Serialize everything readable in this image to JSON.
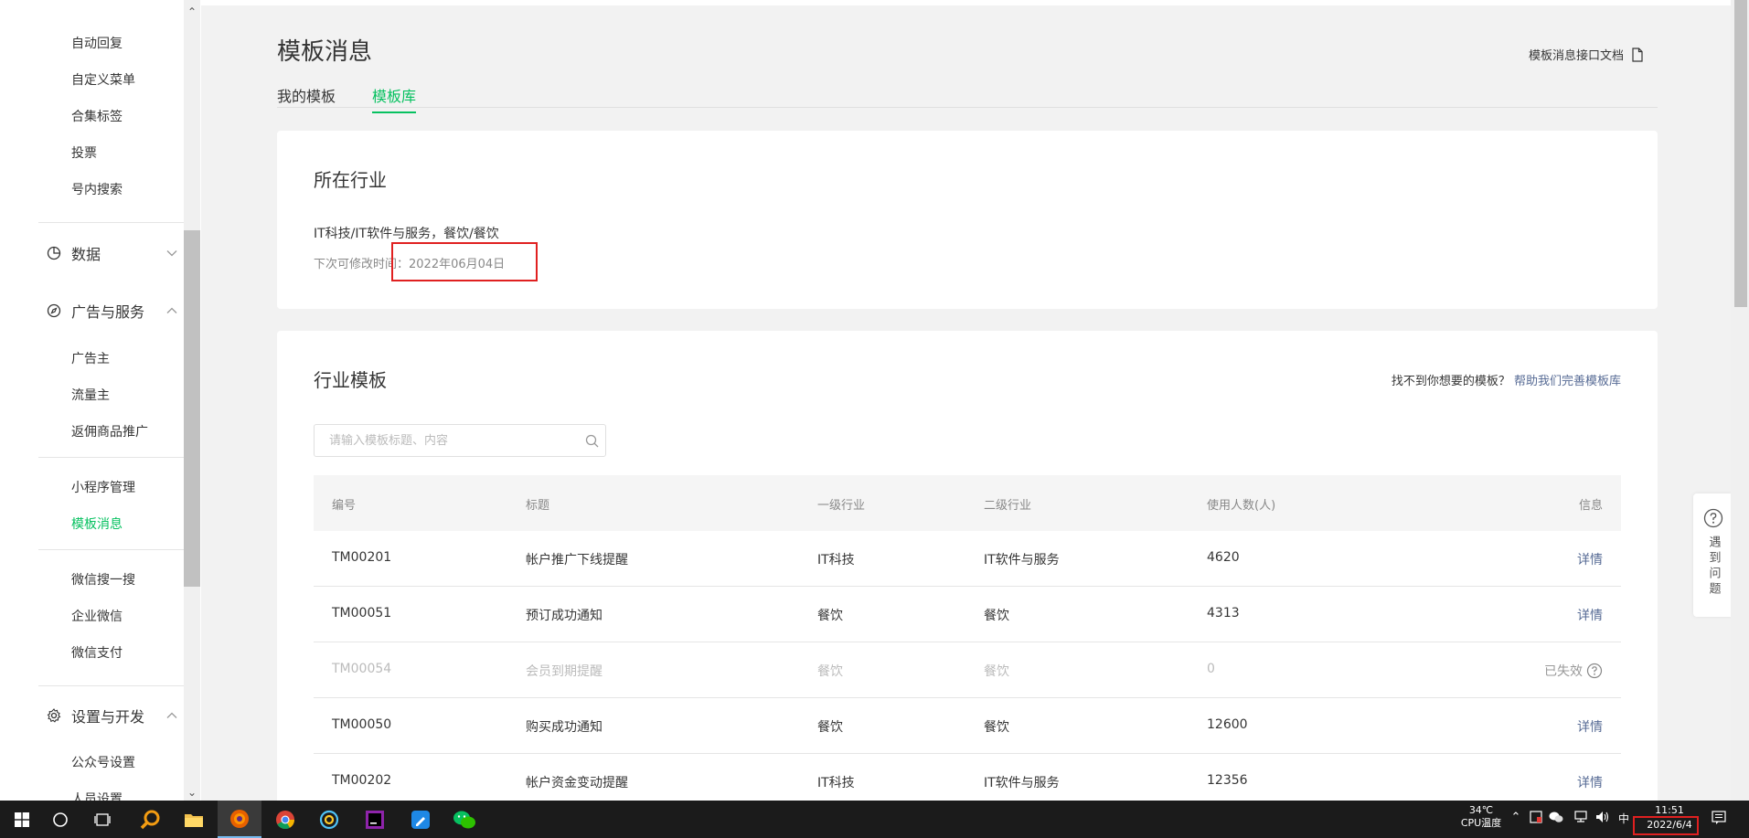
{
  "sidebar": {
    "items_top": [
      {
        "label": "自动回复"
      },
      {
        "label": "自定义菜单"
      },
      {
        "label": "合集标签"
      },
      {
        "label": "投票"
      },
      {
        "label": "号内搜索"
      }
    ],
    "group_data": {
      "label": "数据"
    },
    "group_ads": {
      "label": "广告与服务"
    },
    "items_ads": [
      {
        "label": "广告主"
      },
      {
        "label": "流量主"
      },
      {
        "label": "返佣商品推广"
      }
    ],
    "items_mini": [
      {
        "label": "小程序管理"
      },
      {
        "label": "模板消息"
      }
    ],
    "items_more": [
      {
        "label": "微信搜一搜"
      },
      {
        "label": "企业微信"
      },
      {
        "label": "微信支付"
      }
    ],
    "group_settings": {
      "label": "设置与开发"
    },
    "items_settings": [
      {
        "label": "公众号设置"
      },
      {
        "label": "人员设置"
      }
    ]
  },
  "header": {
    "title": "模板消息",
    "doc_link": "模板消息接口文档",
    "tabs": [
      {
        "label": "我的模板"
      },
      {
        "label": "模板库"
      }
    ]
  },
  "industry": {
    "title": "所在行业",
    "value": "IT科技/IT软件与服务，餐饮/餐饮",
    "modify_label": "下次可修改时间：",
    "modify_date": "2022年06月04日"
  },
  "templates": {
    "title": "行业模板",
    "help_question": "找不到你想要的模板？",
    "help_link": "帮助我们完善模板库",
    "search_placeholder": "请输入模板标题、内容",
    "columns": [
      "编号",
      "标题",
      "一级行业",
      "二级行业",
      "使用人数(人)",
      "信息"
    ],
    "rows": [
      {
        "id": "TM00201",
        "title": "帐户推广下线提醒",
        "primary": "IT科技",
        "secondary": "IT软件与服务",
        "users": "4620",
        "info": "详情"
      },
      {
        "id": "TM00051",
        "title": "预订成功通知",
        "primary": "餐饮",
        "secondary": "餐饮",
        "users": "4313",
        "info": "详情"
      },
      {
        "id": "TM00054",
        "title": "会员到期提醒",
        "primary": "餐饮",
        "secondary": "餐饮",
        "users": "0",
        "info": "已失效"
      },
      {
        "id": "TM00050",
        "title": "购买成功通知",
        "primary": "餐饮",
        "secondary": "餐饮",
        "users": "12600",
        "info": "详情"
      },
      {
        "id": "TM00202",
        "title": "帐户资金变动提醒",
        "primary": "IT科技",
        "secondary": "IT软件与服务",
        "users": "12356",
        "info": "详情"
      }
    ]
  },
  "help_float": {
    "label": "遇到问题"
  },
  "taskbar": {
    "temp": "34℃",
    "temp_label": "CPU温度",
    "ime": "中",
    "time": "11:51",
    "date": "2022/6/4"
  },
  "colors": {
    "accent": "#07c160",
    "link": "#576b95",
    "highlight": "#e02020"
  }
}
